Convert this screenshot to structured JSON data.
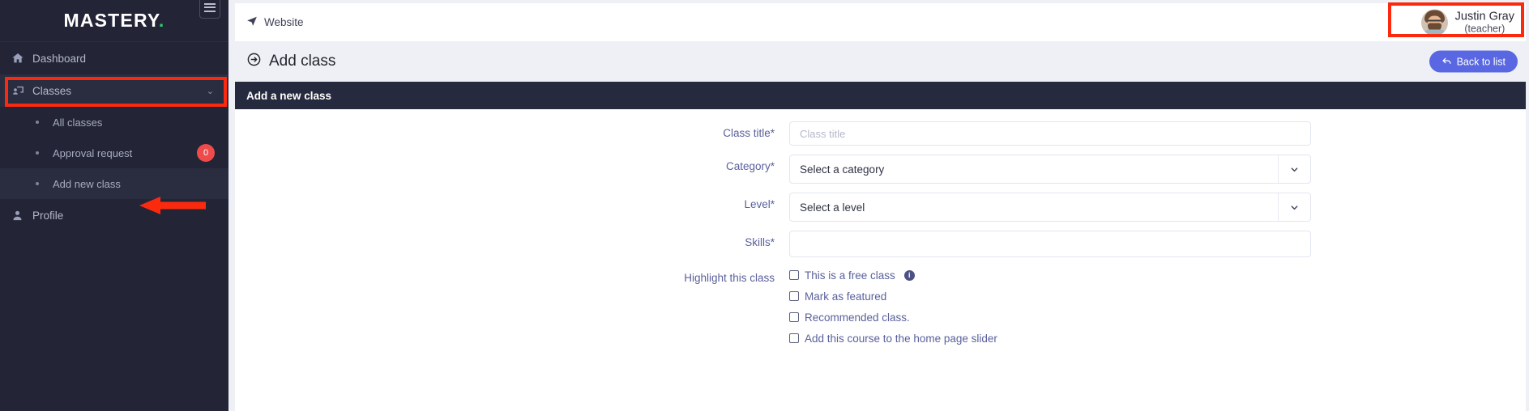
{
  "brand": {
    "name": "MASTERY",
    "dot": "."
  },
  "sidebar": {
    "items": [
      {
        "label": "Dashboard",
        "icon": "home-icon"
      },
      {
        "label": "Classes",
        "icon": "screen-user-icon",
        "chevron": "⌄"
      },
      {
        "label": "Profile",
        "icon": "user-icon"
      }
    ],
    "submenu": [
      {
        "label": "All classes"
      },
      {
        "label": "Approval request",
        "badge": "0"
      },
      {
        "label": "Add new class"
      }
    ]
  },
  "topbar": {
    "website_label": "Website",
    "user_name": "Justin Gray",
    "user_role": "(teacher)"
  },
  "page": {
    "title": "Add class",
    "back_button": "Back to list"
  },
  "card": {
    "header": "Add a new class"
  },
  "form": {
    "fields": [
      {
        "label": "Class title*",
        "placeholder": "Class title",
        "value": "",
        "type": "text"
      },
      {
        "label": "Category*",
        "value": "Select a category",
        "type": "select"
      },
      {
        "label": "Level*",
        "value": "Select a level",
        "type": "select"
      },
      {
        "label": "Skills*",
        "placeholder": "",
        "value": "",
        "type": "text"
      }
    ],
    "highlight_label": "Highlight this class",
    "checkboxes": [
      {
        "label": "This is a free class",
        "checked": false,
        "info": true
      },
      {
        "label": "Mark as featured",
        "checked": false,
        "info": false
      },
      {
        "label": "Recommended class.",
        "checked": false,
        "info": false
      },
      {
        "label": "Add this course to the home page slider",
        "checked": false,
        "info": false
      }
    ]
  },
  "colors": {
    "sidebar_bg": "#232536",
    "accent_button": "#5968e2",
    "label_text": "#5a619c",
    "badge_red": "#ef4b4b",
    "annotation_red": "#fb2a0e",
    "card_header_bg": "#262a3e",
    "brand_dot_green": "#2ecc71"
  }
}
